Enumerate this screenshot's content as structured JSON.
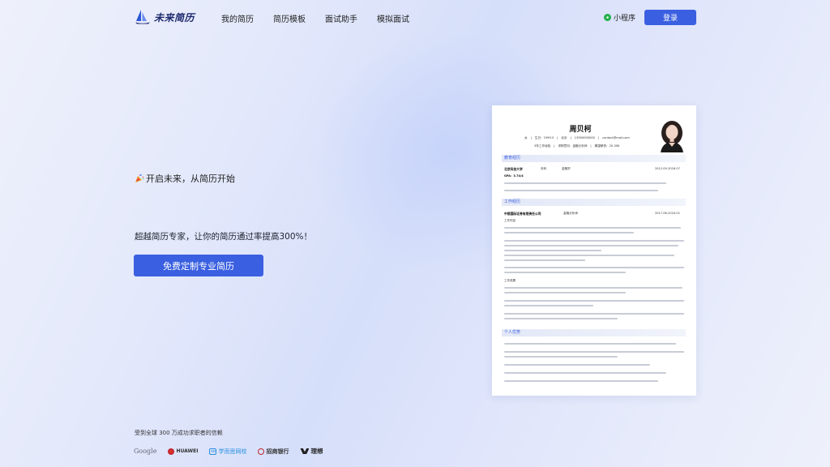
{
  "header": {
    "logo_text": "未来简历",
    "nav": [
      "我的简历",
      "简历模板",
      "面试助手",
      "模拟面试"
    ],
    "mini_program": "小程序",
    "login": "登录"
  },
  "hero": {
    "tagline": "开启未来，从简历开始",
    "headline": "超越简历专家，让你的简历通过率提高300%！",
    "cta": "免费定制专业简历"
  },
  "trust": {
    "text": "受到全球 300 万成功求职者的信赖",
    "brands": [
      "Google",
      "HUAWEI",
      "学而思网校",
      "招商银行",
      "理想"
    ]
  },
  "resume": {
    "name": "周贝柯",
    "info_line1": [
      "女",
      "生日：1999.5",
      "北京",
      "13900000000",
      "contact@mail.com"
    ],
    "info_line2": [
      "3年工作经验",
      "求职意向：金融分析师",
      "期望薪资：20-30K"
    ],
    "sections": {
      "education": "教育经历",
      "work": "工作经历",
      "strength": "个人优势"
    },
    "education": {
      "school": "北京科技大学",
      "degree": "本科",
      "major": "金融学",
      "period": "2012.09-2016.07",
      "gpa": "GPA：3.74/4"
    },
    "work": {
      "company": "中银国际证券有限责任公司",
      "role": "金融分析师",
      "period": "2017.06-2024.01",
      "content_label": "工作内容",
      "result_label": "工作成果"
    }
  },
  "colors": {
    "accent": "#3a5fe0",
    "section_bg": "#e3e8f7",
    "mini_icon": "#23b04a"
  }
}
